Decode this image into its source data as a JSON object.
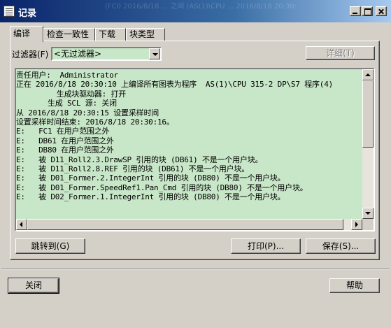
{
  "window": {
    "title": "记录",
    "ghost_text": "(FC0 2016/8/18 ... 之间 (AS(1)\\CPU ... 2016/8/18 20:30:"
  },
  "tabs": [
    {
      "label": "编译",
      "active": true
    },
    {
      "label": "检查一致性",
      "active": false
    },
    {
      "label": "下载",
      "active": false
    },
    {
      "label": "块类型",
      "active": false
    }
  ],
  "filter": {
    "label": "过滤器(F)",
    "value": "<无过滤器>",
    "detail_button": "详细(T)"
  },
  "log": {
    "lines": [
      "责任用户:  Administrator",
      "正在 2016/8/18 20:30:10 上编译所有图表为程序  AS(1)\\CPU 315-2 DP\\S7 程序(4)",
      "         生成块驱动器: 打开",
      "       生成 SCL 源: 关闭",
      "从 2016/8/18 20:30:15 设置采样时间",
      "设置采样时间结束: 2016/8/18 20:30:16。",
      "E:   FC1 在用户范围之外",
      "E:   DB61 在用户范围之外",
      "E:   DB80 在用户范围之外",
      "E:   被 D11_Roll2.3.DrawSP 引用的块 (DB61) 不是一个用户块。",
      "E:   被 D11_Roll2.8.REF 引用的块 (DB61) 不是一个用户块。",
      "E:   被 D01_Former.2.IntegerInt 引用的块 (DB80) 不是一个用户块。",
      "E:   被 D01_Former.SpeedRef1.Pan_Cmd 引用的块 (DB80) 不是一个用户块。",
      "E:   被 D02_Former.1.IntegerInt 引用的块 (DB80) 不是一个用户块。"
    ]
  },
  "buttons": {
    "goto": "跳转到(G)",
    "print": "打印(P)...",
    "save": "保存(S)...",
    "close": "关闭",
    "help": "帮助"
  },
  "colors": {
    "log_background": "#c8e6c8",
    "titlebar_start": "#0a246a",
    "titlebar_end": "#a6caf0",
    "dialog_face": "#d4d0c8"
  }
}
